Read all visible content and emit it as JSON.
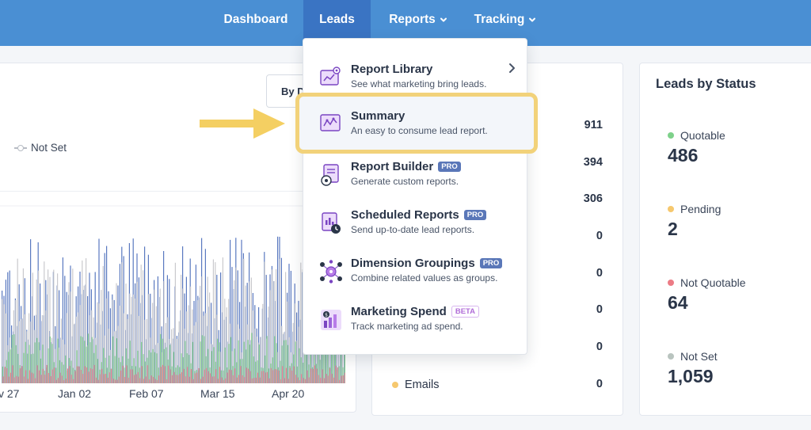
{
  "nav": {
    "items": [
      {
        "label": "Dashboard",
        "has_chevron": false
      },
      {
        "label": "Leads",
        "has_chevron": false,
        "active": true
      },
      {
        "label": "Reports",
        "has_chevron": true
      },
      {
        "label": "Tracking",
        "has_chevron": true
      }
    ]
  },
  "chart_card": {
    "button_label": "By D",
    "legend": {
      "not_set": "Not Set"
    },
    "x_ticks": [
      "v 27",
      "Jan 02",
      "Feb 07",
      "Mar 15",
      "Apr 20"
    ]
  },
  "chart_data": {
    "type": "bar",
    "xlabel": "",
    "ylabel": "",
    "x_ticks": [
      "v 27",
      "Jan 02",
      "Feb 07",
      "Mar 15",
      "Apr 20"
    ],
    "series": [
      {
        "color": "#5a79c0"
      },
      {
        "color": "#c9c9cd"
      },
      {
        "color": "#86cf8d"
      },
      {
        "color": "#e9868b"
      }
    ]
  },
  "mid_card": {
    "values": [
      "911",
      "394",
      "306",
      "0",
      "0",
      "0",
      "0",
      "0"
    ],
    "emails_label": "Emails",
    "emails_color": "#f6c86e"
  },
  "status_card": {
    "title": "Leads by Status",
    "items": [
      {
        "label": "Quotable",
        "value": "486",
        "color": "#7ed18a"
      },
      {
        "label": "Pending",
        "value": "2",
        "color": "#f6c86e"
      },
      {
        "label": "Not Quotable",
        "value": "64",
        "color": "#ec7b85"
      },
      {
        "label": "Not Set",
        "value": "1,059",
        "color": "#b9c4bf"
      }
    ]
  },
  "dropdown": {
    "items": [
      {
        "title": "Report Library",
        "desc": "See what marketing bring leads.",
        "badge": "",
        "icon": "report-library-icon"
      },
      {
        "title": "Summary",
        "desc": "An easy to consume lead report.",
        "badge": "",
        "icon": "summary-chart-icon"
      },
      {
        "title": "Report Builder",
        "desc": "Generate custom reports.",
        "badge": "PRO",
        "icon": "report-builder-icon"
      },
      {
        "title": "Scheduled Reports",
        "desc": "Send up-to-date lead reports.",
        "badge": "PRO",
        "icon": "scheduled-report-icon"
      },
      {
        "title": "Dimension Groupings",
        "desc": "Combine related values as groups.",
        "badge": "PRO",
        "icon": "dimension-groupings-icon"
      },
      {
        "title": "Marketing Spend",
        "desc": "Track marketing ad spend.",
        "badge": "BETA",
        "icon": "marketing-spend-icon"
      }
    ]
  },
  "colors": {
    "nav_bg": "#4a8fd3",
    "nav_active": "#3a74c3",
    "highlight": "#f2d27a",
    "arrow": "#f4cf62",
    "pro_badge": "#5a77b8"
  }
}
